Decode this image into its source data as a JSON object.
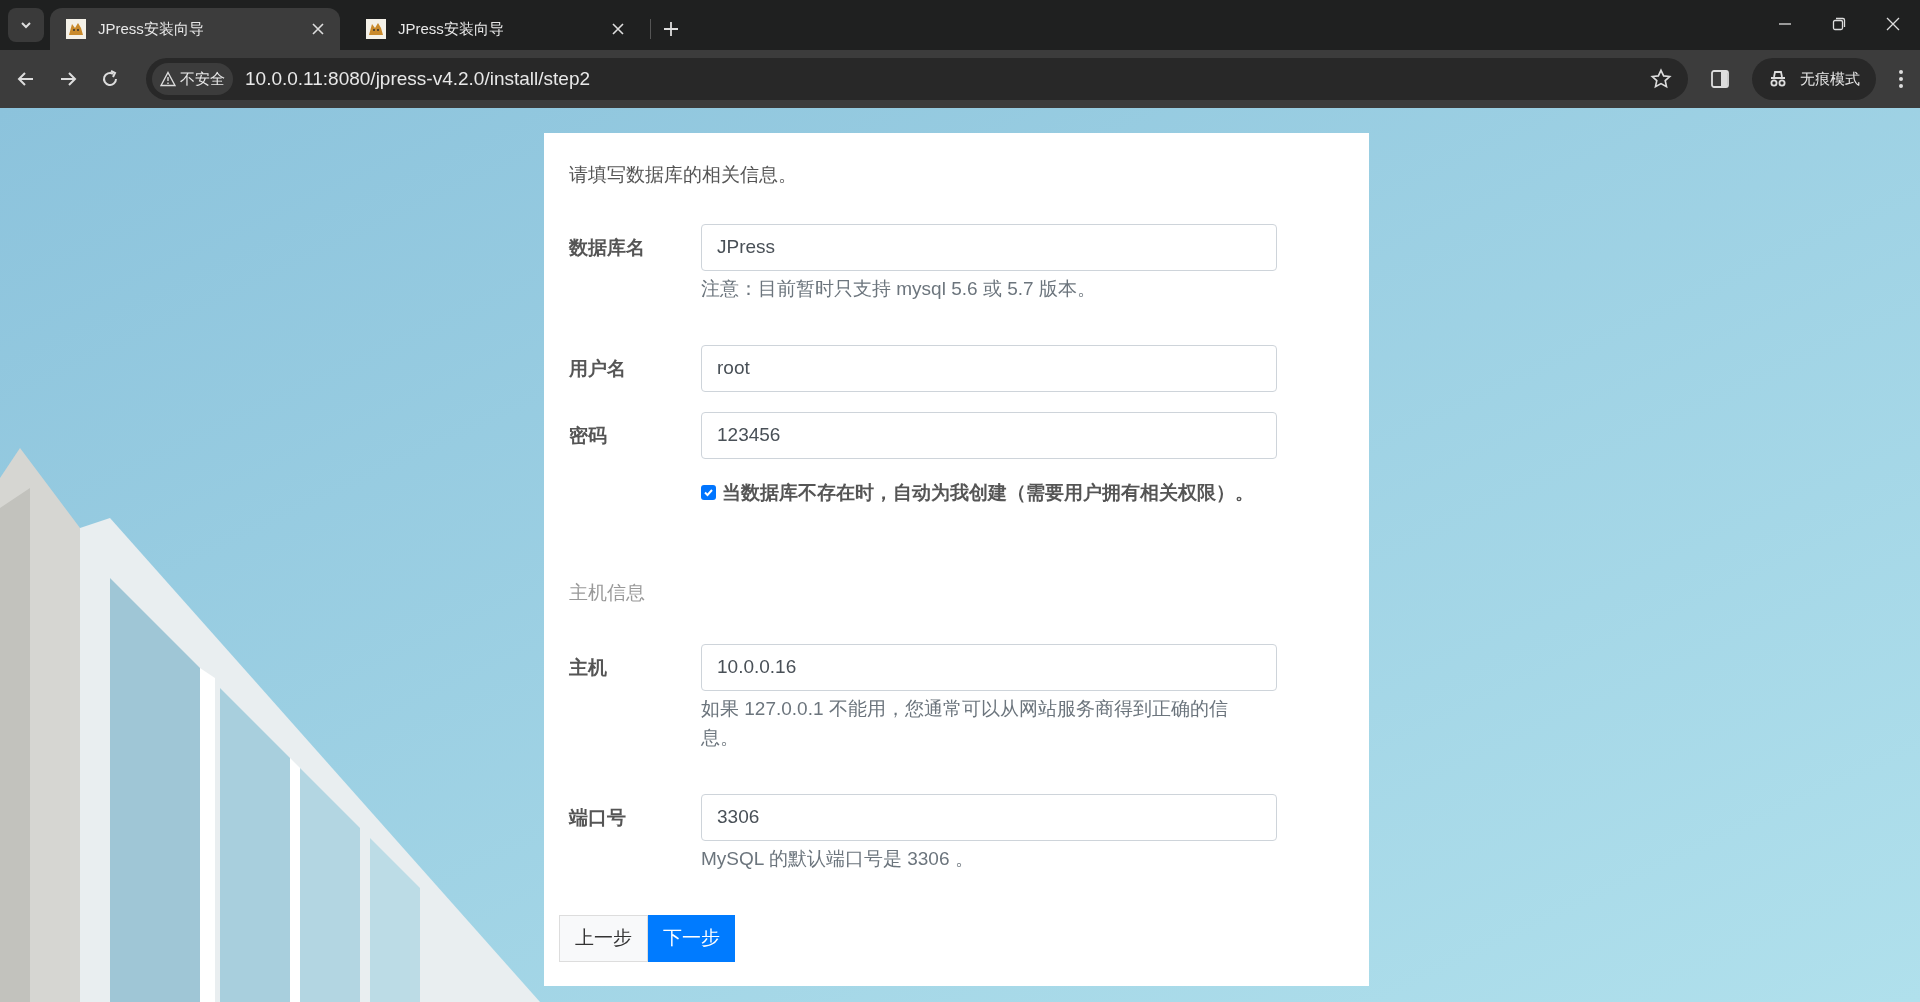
{
  "browser": {
    "tabs": [
      {
        "title": "JPress安装向导",
        "selected": true
      },
      {
        "title": "JPress安装向导",
        "selected": false
      }
    ],
    "security_label": "不安全",
    "url": "10.0.0.11:8080/jpress-v4.2.0/install/step2",
    "incognito_label": "无痕模式"
  },
  "form": {
    "intro": "请填写数据库的相关信息。",
    "rows": [
      {
        "kind": "field",
        "label": "数据库名",
        "value": "JPress",
        "help": "注意：目前暂时只支持 mysql 5.6 或 5.7 版本。"
      },
      {
        "kind": "field",
        "label": "用户名",
        "value": "root"
      },
      {
        "kind": "field",
        "label": "密码",
        "value": "123456"
      },
      {
        "kind": "checkbox",
        "label": "当数据库不存在时，自动为我创建（需要用户拥有相关权限）。",
        "checked": true
      },
      {
        "kind": "section",
        "label": "主机信息"
      },
      {
        "kind": "field",
        "label": "主机",
        "value": "10.0.0.16",
        "help": "如果 127.0.0.1 不能用，您通常可以从网站服务商得到正确的信息。"
      },
      {
        "kind": "field",
        "label": "端口号",
        "value": "3306",
        "help": "MySQL 的默认端口号是 3306 。"
      }
    ],
    "buttons": [
      {
        "label": "上一步",
        "kind": "secondary"
      },
      {
        "label": "下一步",
        "kind": "primary"
      }
    ]
  }
}
